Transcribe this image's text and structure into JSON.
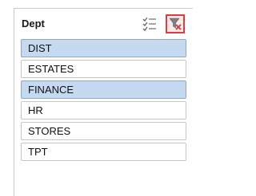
{
  "slicer": {
    "title": "Dept",
    "items": [
      {
        "label": "DIST",
        "selected": true
      },
      {
        "label": "ESTATES",
        "selected": false
      },
      {
        "label": "FINANCE",
        "selected": true
      },
      {
        "label": "HR",
        "selected": false
      },
      {
        "label": "STORES",
        "selected": false
      },
      {
        "label": "TPT",
        "selected": false
      }
    ],
    "icons": {
      "multiselect": "multi-select-icon",
      "clear_filter": "clear-filter-icon"
    },
    "colors": {
      "selected_fill": "#c5daf1",
      "selected_border": "#8ea7c5",
      "item_border": "#c6c6c6",
      "highlight_outline": "#e0393e",
      "filter_icon": "#c0504d"
    }
  }
}
